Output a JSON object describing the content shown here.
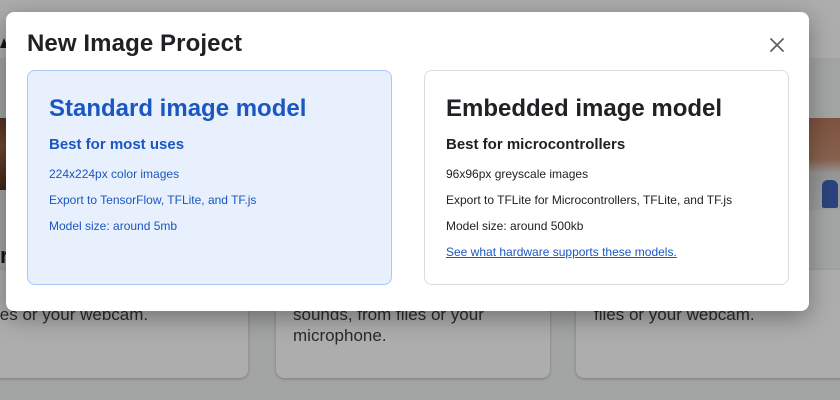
{
  "dialog": {
    "title": "New Image Project",
    "close_icon": "close-icon",
    "options": [
      {
        "title": "Standard image model",
        "subtitle": "Best for most uses",
        "lines": [
          "224x224px color images",
          "Export to TensorFlow, TFLite, and TF.js",
          "Model size: around 5mb"
        ]
      },
      {
        "title": "Embedded image model",
        "subtitle": "Best for microcontrollers",
        "lines": [
          "96x96px greyscale images",
          "Export to TFLite for Microcontrollers, TFLite, and TF.js",
          "Model size: around 500kb"
        ],
        "link": "See what hardware supports these models."
      }
    ]
  },
  "background": {
    "partial_heading": "r",
    "partial_text": "e",
    "cards": [
      {
        "text": "les or your webcam."
      },
      {
        "text": "sounds, from files or your\nmicrophone."
      },
      {
        "text": "files or your webcam."
      }
    ]
  },
  "colors": {
    "accent": "#1a57c0",
    "selected_bg": "#e8f0fe",
    "selected_border": "#a8c7fa",
    "overlay": "rgba(0,0,0,0.32)"
  }
}
